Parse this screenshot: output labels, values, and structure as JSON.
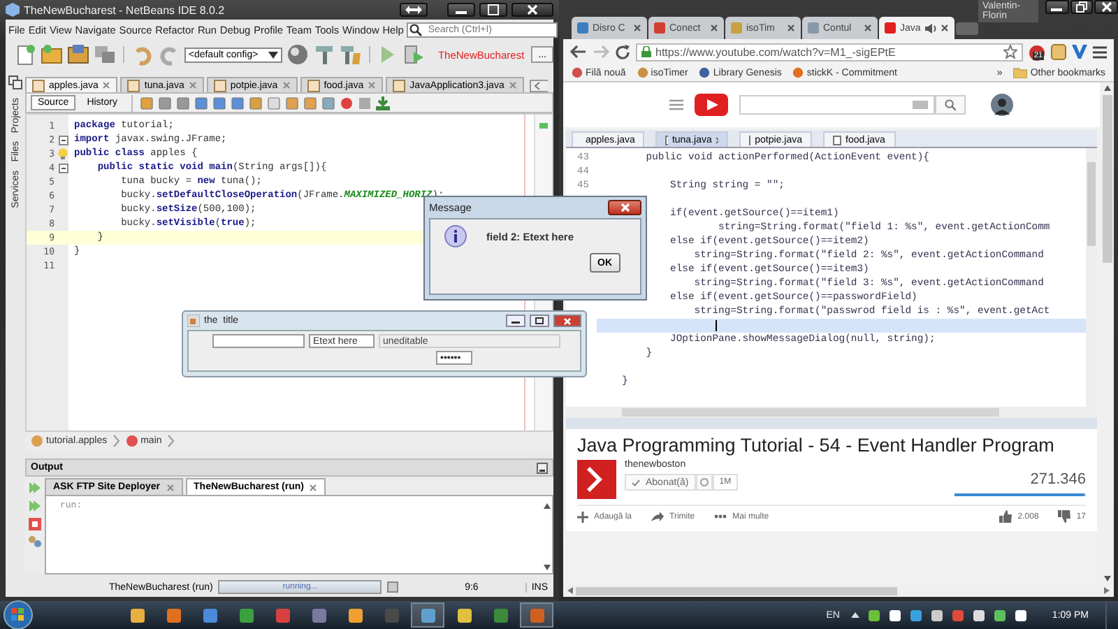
{
  "netbeans": {
    "title": "TheNewBucharest - NetBeans IDE 8.0.2",
    "menu": [
      "File",
      "Edit",
      "View",
      "Navigate",
      "Source",
      "Refactor",
      "Run",
      "Debug",
      "Profile",
      "Team",
      "Tools",
      "Window",
      "Help"
    ],
    "search": {
      "placeholder": "Search (Ctrl+I)"
    },
    "config": "<default config>",
    "project": "TheNewBucharest",
    "more_button": "...",
    "side_tabs": [
      "Projects",
      "Files",
      "Services"
    ],
    "tabs": [
      {
        "label": "apples.java",
        "selected": true
      },
      {
        "label": "tuna.java",
        "selected": false
      },
      {
        "label": "potpie.java",
        "selected": false
      },
      {
        "label": "food.java",
        "selected": false
      },
      {
        "label": "JavaApplication3.java",
        "selected": false
      }
    ],
    "view_tabs": [
      {
        "label": "Source",
        "selected": true
      },
      {
        "label": "History",
        "selected": false
      }
    ],
    "lines": [
      {
        "number": "1",
        "code": "**package** tutorial;",
        "current": false,
        "fold": false,
        "hint": false
      },
      {
        "number": "2",
        "code": "**import** javax.swing.JFrame;",
        "current": false,
        "fold": true,
        "hint": false
      },
      {
        "number": "3",
        "code": "**public class** apples {",
        "current": false,
        "fold": false,
        "hint": true
      },
      {
        "number": "4",
        "code": "    **public static void main**(String args[]){",
        "current": false,
        "fold": true,
        "hint": false
      },
      {
        "number": "5",
        "code": "        tuna bucky = **new** tuna();",
        "current": false,
        "fold": false,
        "hint": false
      },
      {
        "number": "6",
        "code": "        bucky.**setDefaultCloseOperation**(JFrame.*MAXIMIZED_HORIZ*);",
        "current": false,
        "fold": false,
        "hint": false
      },
      {
        "number": "7",
        "code": "        bucky.**setSize**(500,100);",
        "current": false,
        "fold": false,
        "hint": false
      },
      {
        "number": "8",
        "code": "        bucky.**setVisible**(**true**);",
        "current": false,
        "fold": false,
        "hint": false
      },
      {
        "number": "9",
        "code": "    }",
        "current": true,
        "fold": false,
        "hint": false
      },
      {
        "number": "10",
        "code": "}",
        "current": false,
        "fold": false,
        "hint": false
      },
      {
        "number": "11",
        "current": false,
        "fold": false,
        "hint": false
      }
    ],
    "breadcrumb": [
      "tutorial.apples",
      "main"
    ],
    "output": {
      "title": "Output",
      "tabs": [
        {
          "label": "ASK FTP Site Deployer",
          "selected": false
        },
        {
          "label": "TheNewBucharest (run)",
          "selected": true
        }
      ],
      "text": "run:"
    },
    "status": {
      "task": "TheNewBucharest (run)",
      "progress": {
        "text": "running...",
        "level": 1
      },
      "position": "9:6",
      "mode": "INS"
    }
  },
  "browser": {
    "user": "Valentin-Florin",
    "tabs": [
      {
        "label": "Disro C",
        "selected": false
      },
      {
        "label": "Conect",
        "selected": false
      },
      {
        "label": "isoTim",
        "selected": false
      },
      {
        "label": "Contul",
        "selected": false
      },
      {
        "label": "Java",
        "selected": true
      }
    ],
    "url": "https://www.youtube.com/watch?v=M1_-sigEPtE",
    "extension_badge": "21",
    "bookmarks": [
      "Filă nouă",
      "isoTimer",
      "Library Genesis",
      "stickK - Commitment"
    ],
    "bookmarks_more": "»",
    "other_bookmarks": "Other bookmarks"
  },
  "video": {
    "tabs": [
      {
        "label": "apples.java",
        "selected": false
      },
      {
        "label": "tuna.java",
        "selected": true
      },
      {
        "label": "potpie.java",
        "selected": false
      },
      {
        "label": "food.java",
        "selected": false
      }
    ],
    "line_numbers": [
      "43",
      "44",
      "45"
    ],
    "lines": [
      {
        "text": "    public void actionPerformed(ActionEvent event){",
        "cursor": false
      },
      {
        "cursor": false
      },
      {
        "text": "        String string = \"\";",
        "cursor": false
      },
      {
        "cursor": false
      },
      {
        "text": "        if(event.getSource()==item1)",
        "cursor": false
      },
      {
        "text": "                string=String.format(\"field 1: %s\", event.getActionComm",
        "cursor": false
      },
      {
        "text": "        else if(event.getSource()==item2)",
        "cursor": false
      },
      {
        "text": "            string=String.format(\"field 2: %s\", event.getActionCommand",
        "cursor": false
      },
      {
        "text": "        else if(event.getSource()==item3)",
        "cursor": false
      },
      {
        "text": "            string=String.format(\"field 3: %s\", event.getActionCommand",
        "cursor": false
      },
      {
        "text": "        else if(event.getSource()==passwordField)",
        "cursor": false
      },
      {
        "text": "            string=String.format(\"passwrod field is : %s\", event.getAct",
        "cursor": false
      },
      {
        "cursor": true
      },
      {
        "text": "        JOptionPane.showMessageDialog(null, string);",
        "cursor": false
      },
      {
        "text": "    }",
        "cursor": false
      },
      {
        "cursor": false
      },
      {
        "text": "}",
        "cursor": false
      }
    ]
  },
  "youtube": {
    "title": "Java Programming Tutorial - 54 - Event Handler Program",
    "channel": "thenewboston",
    "subscribe": "Abonat(ă)",
    "subscribers": "1M",
    "views": "271.346",
    "likes_bar": {
      "level": 0.99
    },
    "actions": [
      "Adaugă la",
      "Trimite",
      "Mai multe"
    ],
    "likes": "2.008",
    "dislikes": "17"
  },
  "message_dialog": {
    "title": "Message",
    "text": "field 2: Etext here",
    "button": "OK"
  },
  "frame": {
    "title": "the  title",
    "fields": [
      {
        "kind": "text",
        "disabled": false
      },
      {
        "kind": "text",
        "value": "Etext here",
        "disabled": false
      },
      {
        "kind": "text",
        "value": "uneditable",
        "disabled": true
      },
      {
        "kind": "password",
        "value": "••••••",
        "disabled": false
      }
    ]
  },
  "taskbar": {
    "language": "EN",
    "time": "1:09 PM"
  }
}
